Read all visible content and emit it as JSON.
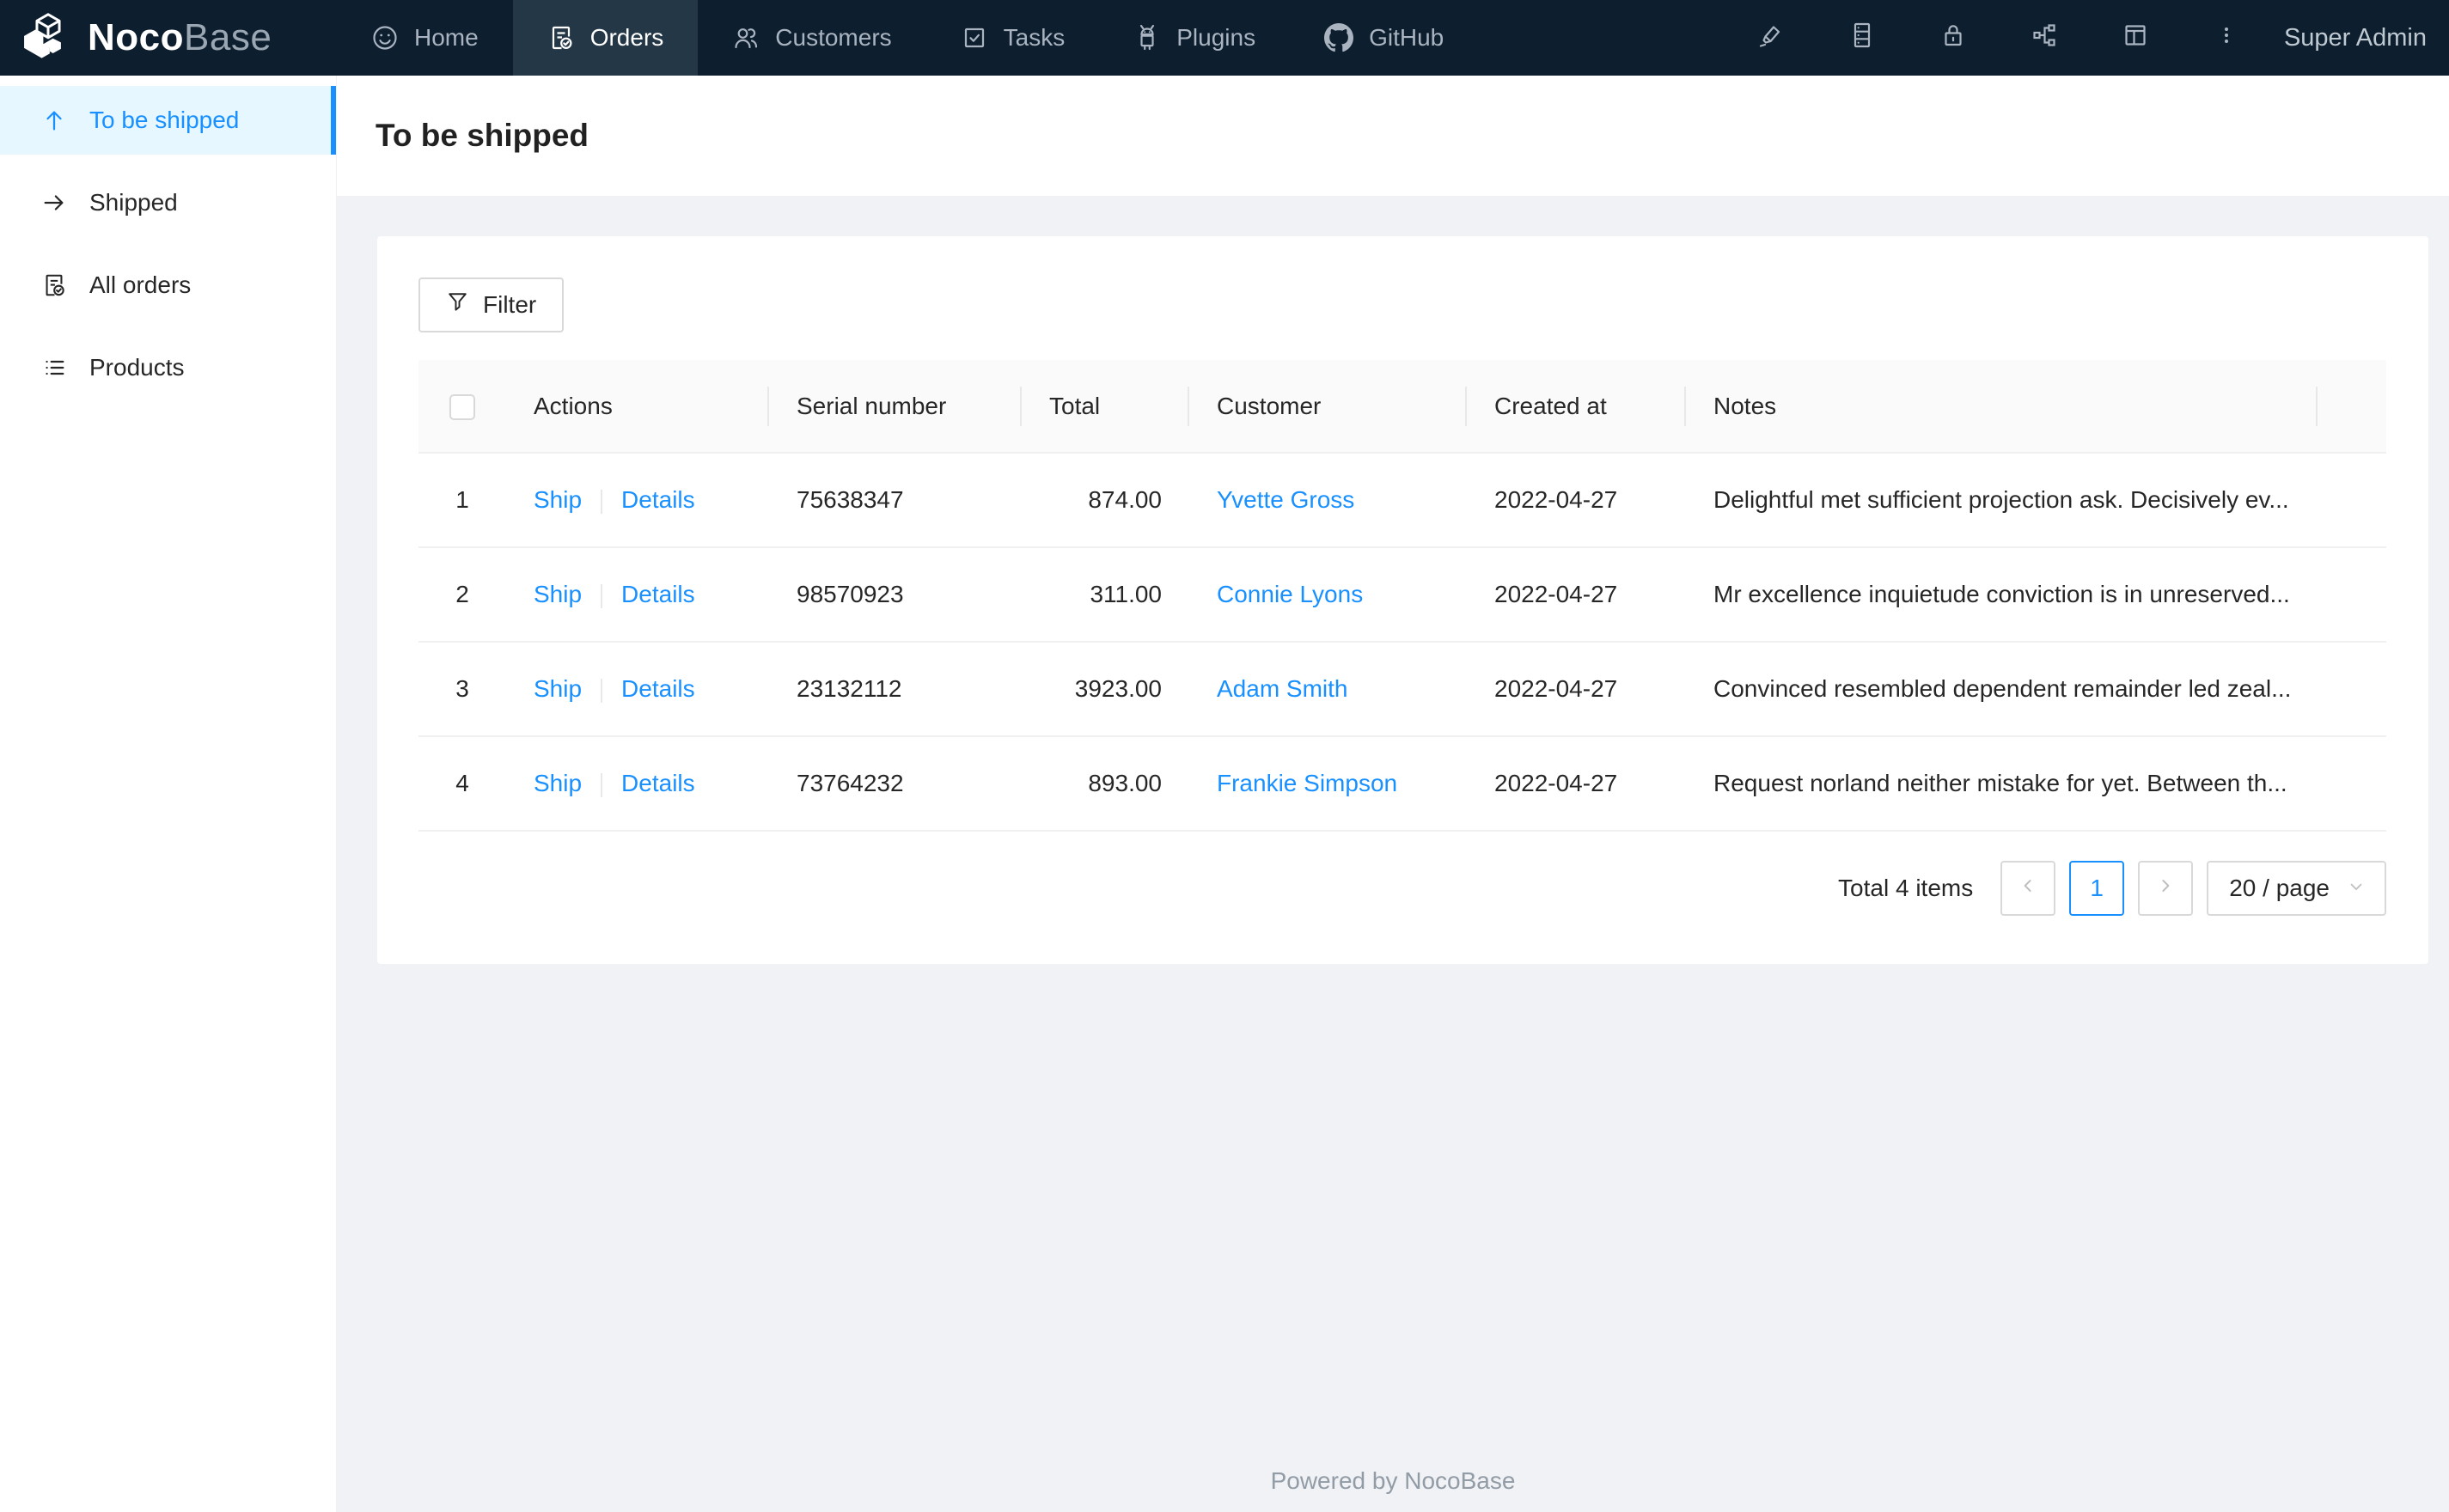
{
  "navbar": {
    "logo": {
      "bold": "Noco",
      "light": "Base"
    },
    "items": [
      {
        "label": "Home",
        "icon": "smile-icon",
        "active": false
      },
      {
        "label": "Orders",
        "icon": "file-done-icon",
        "active": true
      },
      {
        "label": "Customers",
        "icon": "team-icon",
        "active": false
      },
      {
        "label": "Tasks",
        "icon": "check-square-icon",
        "active": false
      },
      {
        "label": "Plugins",
        "icon": "android-icon",
        "active": false
      },
      {
        "label": "GitHub",
        "icon": "github-icon",
        "active": false
      }
    ],
    "right_icons": [
      "highlight-icon",
      "database-icon",
      "lock-icon",
      "partition-icon",
      "layout-icon",
      "more-icon"
    ],
    "user": "Super Admin"
  },
  "sidebar": {
    "items": [
      {
        "label": "To be shipped",
        "icon": "arrow-up-icon",
        "active": true
      },
      {
        "label": "Shipped",
        "icon": "arrow-right-icon",
        "active": false
      },
      {
        "label": "All orders",
        "icon": "file-done-icon",
        "active": false
      },
      {
        "label": "Products",
        "icon": "unordered-list-icon",
        "active": false
      }
    ]
  },
  "page": {
    "title": "To be shipped"
  },
  "toolbar": {
    "filter_label": "Filter"
  },
  "table": {
    "columns": [
      "",
      "Actions",
      "Serial number",
      "Total",
      "Customer",
      "Created at",
      "Notes"
    ],
    "rows": [
      {
        "index": "1",
        "ship": "Ship",
        "details": "Details",
        "serial": "75638347",
        "total": "874.00",
        "customer": "Yvette Gross",
        "created_at": "2022-04-27",
        "notes": "Delightful met sufficient projection ask. Decisively ev..."
      },
      {
        "index": "2",
        "ship": "Ship",
        "details": "Details",
        "serial": "98570923",
        "total": "311.00",
        "customer": "Connie Lyons",
        "created_at": "2022-04-27",
        "notes": "Mr excellence inquietude conviction is in unreserved..."
      },
      {
        "index": "3",
        "ship": "Ship",
        "details": "Details",
        "serial": "23132112",
        "total": "3923.00",
        "customer": "Adam Smith",
        "created_at": "2022-04-27",
        "notes": "Convinced resembled dependent remainder led zeal..."
      },
      {
        "index": "4",
        "ship": "Ship",
        "details": "Details",
        "serial": "73764232",
        "total": "893.00",
        "customer": "Frankie Simpson",
        "created_at": "2022-04-27",
        "notes": "Request norland neither mistake for yet. Between th..."
      }
    ]
  },
  "pagination": {
    "total_text": "Total 4 items",
    "current_page": "1",
    "page_size": "20 / page"
  },
  "footer": {
    "text": "Powered by NocoBase"
  },
  "colors": {
    "accent": "#1890ff",
    "navbar_bg": "#0d1e2e",
    "navbar_active_bg": "#243747",
    "page_bg": "#f0f2f5",
    "table_header_bg": "#fafafa",
    "link": "#1890ff",
    "active_item_bg": "#e6f7ff"
  }
}
